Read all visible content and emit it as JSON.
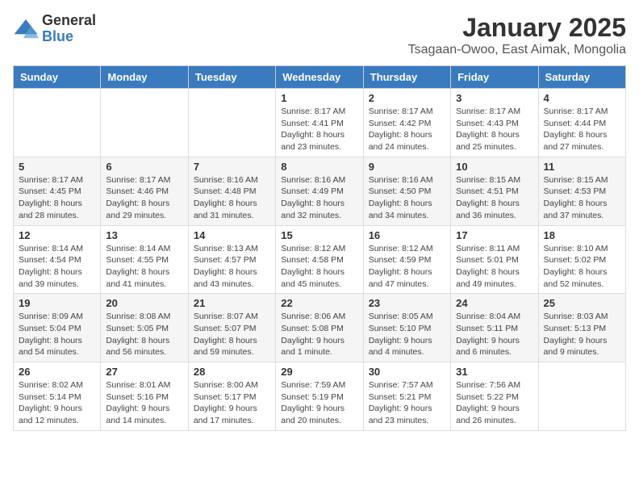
{
  "header": {
    "logo_general": "General",
    "logo_blue": "Blue",
    "title": "January 2025",
    "subtitle": "Tsagaan-Owoo, East Aimak, Mongolia"
  },
  "weekdays": [
    "Sunday",
    "Monday",
    "Tuesday",
    "Wednesday",
    "Thursday",
    "Friday",
    "Saturday"
  ],
  "weeks": [
    [
      {
        "day": "",
        "info": ""
      },
      {
        "day": "",
        "info": ""
      },
      {
        "day": "",
        "info": ""
      },
      {
        "day": "1",
        "info": "Sunrise: 8:17 AM\nSunset: 4:41 PM\nDaylight: 8 hours\nand 23 minutes."
      },
      {
        "day": "2",
        "info": "Sunrise: 8:17 AM\nSunset: 4:42 PM\nDaylight: 8 hours\nand 24 minutes."
      },
      {
        "day": "3",
        "info": "Sunrise: 8:17 AM\nSunset: 4:43 PM\nDaylight: 8 hours\nand 25 minutes."
      },
      {
        "day": "4",
        "info": "Sunrise: 8:17 AM\nSunset: 4:44 PM\nDaylight: 8 hours\nand 27 minutes."
      }
    ],
    [
      {
        "day": "5",
        "info": "Sunrise: 8:17 AM\nSunset: 4:45 PM\nDaylight: 8 hours\nand 28 minutes."
      },
      {
        "day": "6",
        "info": "Sunrise: 8:17 AM\nSunset: 4:46 PM\nDaylight: 8 hours\nand 29 minutes."
      },
      {
        "day": "7",
        "info": "Sunrise: 8:16 AM\nSunset: 4:48 PM\nDaylight: 8 hours\nand 31 minutes."
      },
      {
        "day": "8",
        "info": "Sunrise: 8:16 AM\nSunset: 4:49 PM\nDaylight: 8 hours\nand 32 minutes."
      },
      {
        "day": "9",
        "info": "Sunrise: 8:16 AM\nSunset: 4:50 PM\nDaylight: 8 hours\nand 34 minutes."
      },
      {
        "day": "10",
        "info": "Sunrise: 8:15 AM\nSunset: 4:51 PM\nDaylight: 8 hours\nand 36 minutes."
      },
      {
        "day": "11",
        "info": "Sunrise: 8:15 AM\nSunset: 4:53 PM\nDaylight: 8 hours\nand 37 minutes."
      }
    ],
    [
      {
        "day": "12",
        "info": "Sunrise: 8:14 AM\nSunset: 4:54 PM\nDaylight: 8 hours\nand 39 minutes."
      },
      {
        "day": "13",
        "info": "Sunrise: 8:14 AM\nSunset: 4:55 PM\nDaylight: 8 hours\nand 41 minutes."
      },
      {
        "day": "14",
        "info": "Sunrise: 8:13 AM\nSunset: 4:57 PM\nDaylight: 8 hours\nand 43 minutes."
      },
      {
        "day": "15",
        "info": "Sunrise: 8:12 AM\nSunset: 4:58 PM\nDaylight: 8 hours\nand 45 minutes."
      },
      {
        "day": "16",
        "info": "Sunrise: 8:12 AM\nSunset: 4:59 PM\nDaylight: 8 hours\nand 47 minutes."
      },
      {
        "day": "17",
        "info": "Sunrise: 8:11 AM\nSunset: 5:01 PM\nDaylight: 8 hours\nand 49 minutes."
      },
      {
        "day": "18",
        "info": "Sunrise: 8:10 AM\nSunset: 5:02 PM\nDaylight: 8 hours\nand 52 minutes."
      }
    ],
    [
      {
        "day": "19",
        "info": "Sunrise: 8:09 AM\nSunset: 5:04 PM\nDaylight: 8 hours\nand 54 minutes."
      },
      {
        "day": "20",
        "info": "Sunrise: 8:08 AM\nSunset: 5:05 PM\nDaylight: 8 hours\nand 56 minutes."
      },
      {
        "day": "21",
        "info": "Sunrise: 8:07 AM\nSunset: 5:07 PM\nDaylight: 8 hours\nand 59 minutes."
      },
      {
        "day": "22",
        "info": "Sunrise: 8:06 AM\nSunset: 5:08 PM\nDaylight: 9 hours\nand 1 minute."
      },
      {
        "day": "23",
        "info": "Sunrise: 8:05 AM\nSunset: 5:10 PM\nDaylight: 9 hours\nand 4 minutes."
      },
      {
        "day": "24",
        "info": "Sunrise: 8:04 AM\nSunset: 5:11 PM\nDaylight: 9 hours\nand 6 minutes."
      },
      {
        "day": "25",
        "info": "Sunrise: 8:03 AM\nSunset: 5:13 PM\nDaylight: 9 hours\nand 9 minutes."
      }
    ],
    [
      {
        "day": "26",
        "info": "Sunrise: 8:02 AM\nSunset: 5:14 PM\nDaylight: 9 hours\nand 12 minutes."
      },
      {
        "day": "27",
        "info": "Sunrise: 8:01 AM\nSunset: 5:16 PM\nDaylight: 9 hours\nand 14 minutes."
      },
      {
        "day": "28",
        "info": "Sunrise: 8:00 AM\nSunset: 5:17 PM\nDaylight: 9 hours\nand 17 minutes."
      },
      {
        "day": "29",
        "info": "Sunrise: 7:59 AM\nSunset: 5:19 PM\nDaylight: 9 hours\nand 20 minutes."
      },
      {
        "day": "30",
        "info": "Sunrise: 7:57 AM\nSunset: 5:21 PM\nDaylight: 9 hours\nand 23 minutes."
      },
      {
        "day": "31",
        "info": "Sunrise: 7:56 AM\nSunset: 5:22 PM\nDaylight: 9 hours\nand 26 minutes."
      },
      {
        "day": "",
        "info": ""
      }
    ]
  ]
}
